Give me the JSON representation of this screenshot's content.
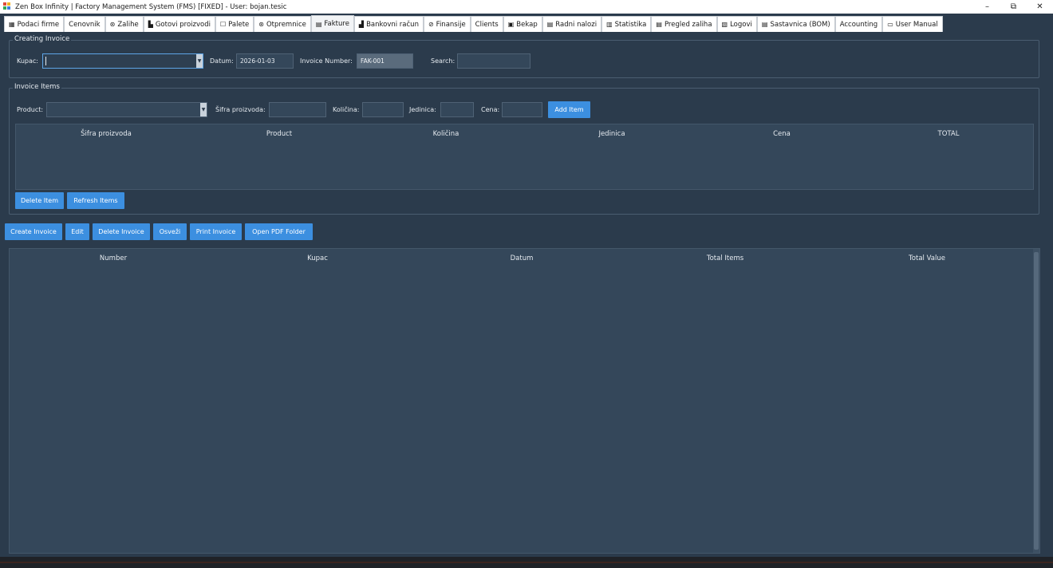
{
  "window": {
    "title": "Zen Box Infinity | Factory Management System (FMS) [FIXED] - User: bojan.tesic",
    "controls": {
      "minimize": "–",
      "restore": "⧉",
      "close": "✕"
    }
  },
  "tabs": [
    {
      "icon": "building-icon",
      "glyph": "▦",
      "label": "Podaci firme"
    },
    {
      "icon": "",
      "glyph": "",
      "label": "Cenovnik"
    },
    {
      "icon": "box-icon",
      "glyph": "⊛",
      "label": "Zalihe"
    },
    {
      "icon": "factory-icon",
      "glyph": "▙",
      "label": "Gotovi proizvodi"
    },
    {
      "icon": "pallet-icon",
      "glyph": "☐",
      "label": "Palete"
    },
    {
      "icon": "box-icon",
      "glyph": "⊛",
      "label": "Otpremnice"
    },
    {
      "icon": "invoice-icon",
      "glyph": "▤",
      "label": "Fakture",
      "active": true
    },
    {
      "icon": "bank-icon",
      "glyph": "▟",
      "label": "Bankovni račun"
    },
    {
      "icon": "money-icon",
      "glyph": "⊘",
      "label": "Finansije"
    },
    {
      "icon": "",
      "glyph": "",
      "label": "Clients"
    },
    {
      "icon": "save-icon",
      "glyph": "▣",
      "label": "Bekap"
    },
    {
      "icon": "clipboard-icon",
      "glyph": "▤",
      "label": "Radni nalozi"
    },
    {
      "icon": "chart-icon",
      "glyph": "▥",
      "label": "Statistika"
    },
    {
      "icon": "list-icon",
      "glyph": "▤",
      "label": "Pregled zaliha"
    },
    {
      "icon": "log-icon",
      "glyph": "▧",
      "label": "Logovi"
    },
    {
      "icon": "bom-icon",
      "glyph": "▤",
      "label": "Sastavnica (BOM)"
    },
    {
      "icon": "",
      "glyph": "",
      "label": "Accounting"
    },
    {
      "icon": "book-icon",
      "glyph": "▭",
      "label": "User Manual"
    }
  ],
  "creating_invoice": {
    "title": "Creating Invoice",
    "kupac_label": "Kupac:",
    "kupac_value": "",
    "datum_label": "Datum:",
    "datum_value": "2026-01-03",
    "invoice_number_label": "Invoice Number:",
    "invoice_number_value": "FAK-001",
    "search_label": "Search:",
    "search_value": ""
  },
  "invoice_items": {
    "title": "Invoice Items",
    "product_label": "Product:",
    "sifra_label": "Šifra proizvoda:",
    "kolicina_label": "Količina:",
    "jedinica_label": "Jedinica:",
    "cena_label": "Cena:",
    "add_item": "Add Item",
    "columns": [
      "Šifra proizvoda",
      "Product",
      "Količina",
      "Jedinica",
      "Cena",
      "TOTAL"
    ],
    "delete_item": "Delete Item",
    "refresh_items": "Refresh Items"
  },
  "actions": {
    "create_invoice": "Create Invoice",
    "edit": "Edit",
    "delete_invoice": "Delete Invoice",
    "osvezi": "Osveži",
    "print_invoice": "Print Invoice",
    "open_pdf_folder": "Open PDF Folder"
  },
  "invoices_table": {
    "columns": [
      "Number",
      "Kupac",
      "Datum",
      "Total Items",
      "Total Value"
    ]
  },
  "colors": {
    "background": "#2b3b4c",
    "accent": "#3c8fe0",
    "field": "#34475a"
  }
}
